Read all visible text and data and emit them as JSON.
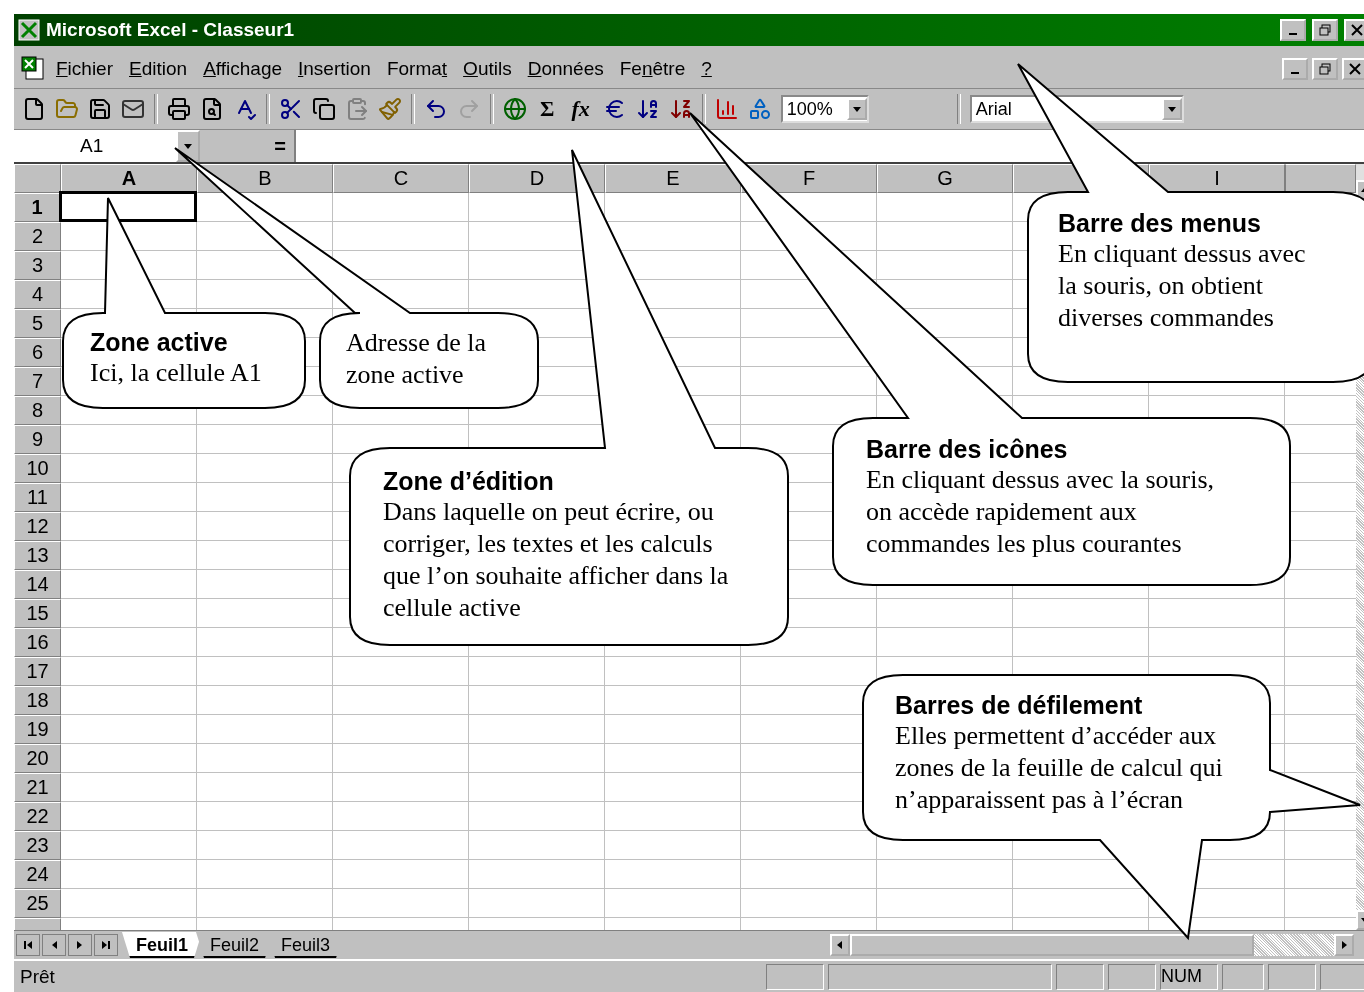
{
  "window": {
    "title": "Microsoft Excel - Classeur1"
  },
  "menu": [
    {
      "key": "F",
      "rest": "ichier"
    },
    {
      "key": "E",
      "rest": "dition"
    },
    {
      "key": "A",
      "rest": "ffichage"
    },
    {
      "key": "I",
      "rest": "nsertion"
    },
    {
      "prefix": "Forma",
      "key": "t"
    },
    {
      "key": "O",
      "rest": "utils"
    },
    {
      "key": "D",
      "rest": "onnées"
    },
    {
      "prefix": "Fe",
      "key": "n",
      "rest": "être"
    },
    {
      "key": "?"
    }
  ],
  "toolbar": {
    "sum": "Σ",
    "function": "fx",
    "zoom": "100%",
    "font": "Arial"
  },
  "formula_bar": {
    "name_box": "A1",
    "equals": "="
  },
  "columns": [
    {
      "label": "A",
      "selected": true
    },
    {
      "label": "B",
      "selected": false
    },
    {
      "label": "C",
      "selected": false
    },
    {
      "label": "D",
      "selected": false
    },
    {
      "label": "E",
      "selected": false
    },
    {
      "label": "F",
      "selected": false
    },
    {
      "label": "G",
      "selected": false
    },
    {
      "selected": false
    },
    {
      "label": "I",
      "selected": false
    }
  ],
  "rows": [
    {
      "label": "1",
      "selected": true
    },
    {
      "label": "2",
      "selected": false
    },
    {
      "label": "3",
      "selected": false
    },
    {
      "label": "4",
      "selected": false
    },
    {
      "label": "5",
      "selected": false
    },
    {
      "label": "6",
      "selected": false
    },
    {
      "label": "7",
      "selected": false
    },
    {
      "label": "8",
      "selected": false
    },
    {
      "label": "9",
      "selected": false
    },
    {
      "label": "10",
      "selected": false
    },
    {
      "label": "11",
      "selected": false
    },
    {
      "label": "12",
      "selected": false
    },
    {
      "label": "13",
      "selected": false
    },
    {
      "label": "14",
      "selected": false
    },
    {
      "label": "15",
      "selected": false
    },
    {
      "label": "16",
      "selected": false
    },
    {
      "label": "17",
      "selected": false
    },
    {
      "label": "18",
      "selected": false
    },
    {
      "label": "19",
      "selected": false
    },
    {
      "label": "20",
      "selected": false
    },
    {
      "label": "21",
      "selected": false
    },
    {
      "label": "22",
      "selected": false
    },
    {
      "label": "23",
      "selected": false
    },
    {
      "label": "24",
      "selected": false
    },
    {
      "label": "25",
      "selected": false
    }
  ],
  "sheet_tabs": [
    {
      "label": "Feuil1",
      "selected": true
    },
    {
      "label": "Feuil2",
      "selected": false
    },
    {
      "label": "Feuil3",
      "selected": false
    }
  ],
  "status_bar": {
    "text": "Prêt",
    "indicator": "NUM"
  },
  "callouts": [
    {
      "title": "Zone active",
      "body": "Ici, la cellule A1"
    },
    {
      "body": "Adresse de la zone active"
    },
    {
      "title": "Zone d’édition",
      "body": "Dans laquelle on peut écrire, ou corriger, les textes et les calculs que l’on souhaite afficher dans la cellule active"
    },
    {
      "title": "Barre des icônes",
      "body": "En cliquant dessus avec la souris, on accède rapidement aux commandes les plus courantes"
    },
    {
      "title": "Barre des menus",
      "body": "En cliquant dessus avec la souris, on obtient diverses commandes"
    },
    {
      "title": "Barres de défilement",
      "body": "Elles permettent d’accéder aux zones de la feuille de calcul qui n’apparaissent pas à l’écran"
    }
  ]
}
